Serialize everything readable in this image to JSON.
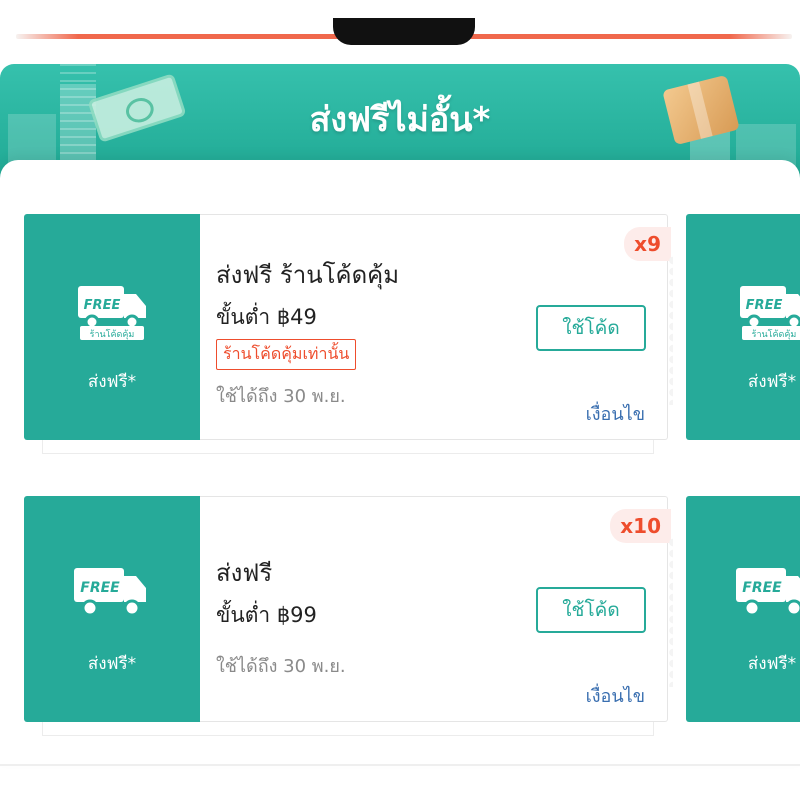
{
  "banner": {
    "title": "ส่งฟรีไม่อั้น*"
  },
  "vouchers": [
    {
      "left_label": "ส่งฟรี*",
      "left_badge_top": "FREE",
      "left_badge_sub": "ร้านโค้ดคุ้ม",
      "title": "ส่งฟรี ร้านโค้ดคุ้ม",
      "min_spend": "ขั้นต่ำ ฿49",
      "tag": "ร้านโค้ดคุ้มเท่านั้น",
      "expiry": "ใช้ได้ถึง 30 พ.ย.",
      "button": "ใช้โค้ด",
      "terms": "เงื่อนไข",
      "quantity": "x9"
    },
    {
      "left_label": "ส่งฟรี*",
      "left_badge_top": "FREE",
      "title": "ส่งฟรี",
      "min_spend": "ขั้นต่ำ ฿99",
      "expiry": "ใช้ได้ถึง 30 พ.ย.",
      "button": "ใช้โค้ด",
      "terms": "เงื่อนไข",
      "quantity": "x10"
    }
  ],
  "peek": [
    {
      "left_label": "ส่งฟรี*",
      "left_badge_top": "FREE",
      "left_badge_sub": "ร้านโค้ดคุ้ม"
    },
    {
      "left_label": "ส่งฟรี*",
      "left_badge_top": "FREE"
    }
  ],
  "colors": {
    "accent": "#26aa99",
    "brand": "#ee4d2d",
    "link": "#3a6fb0"
  },
  "icons": [
    "free-shipping-truck-icon",
    "cash-icon",
    "parcel-box-icon"
  ]
}
